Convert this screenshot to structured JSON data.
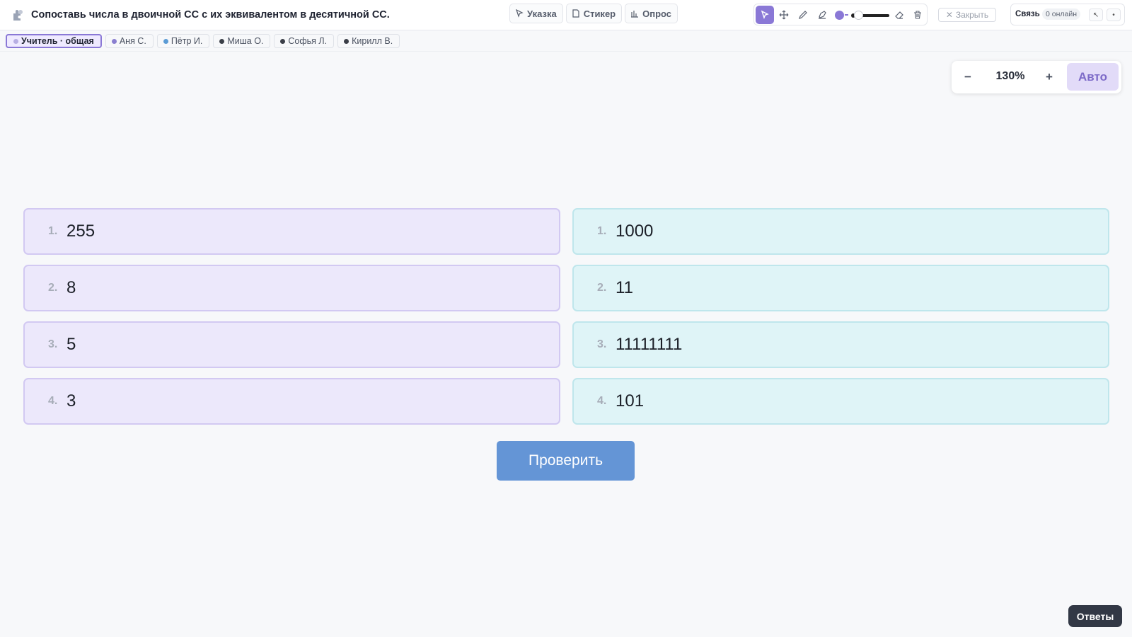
{
  "header": {
    "title": "Сопоставь числа в двоичной СС с их эквивалентом в десятичной СС.",
    "tools": [
      {
        "label": "Указка",
        "icon": "pointer-icon"
      },
      {
        "label": "Стикер",
        "icon": "sticker-icon"
      },
      {
        "label": "Опрос",
        "icon": "poll-icon"
      }
    ],
    "close_label": "Закрыть",
    "connection_label": "Связь",
    "online_label": "0 онлайн"
  },
  "tabs": [
    {
      "label": "Учитель · общая",
      "active": true,
      "dot_color": "#b7aee3"
    },
    {
      "label": "Аня С.",
      "active": false,
      "dot_color": "#8a7fd0"
    },
    {
      "label": "Пётр И.",
      "active": false,
      "dot_color": "#5b9bd5"
    },
    {
      "label": "Миша О.",
      "active": false,
      "dot_color": "#3b3f48"
    },
    {
      "label": "Софья Л.",
      "active": false,
      "dot_color": "#3b3f48"
    },
    {
      "label": "Кирилл В.",
      "active": false,
      "dot_color": "#3b3f48"
    }
  ],
  "zoom": {
    "minus": "−",
    "value": "130%",
    "plus": "+",
    "auto": "Авто"
  },
  "left_items": [
    {
      "num": "1.",
      "value": "255"
    },
    {
      "num": "2.",
      "value": "8"
    },
    {
      "num": "3.",
      "value": "5"
    },
    {
      "num": "4.",
      "value": "3"
    }
  ],
  "right_items": [
    {
      "num": "1.",
      "value": "1000"
    },
    {
      "num": "2.",
      "value": "11"
    },
    {
      "num": "3.",
      "value": "11111111"
    },
    {
      "num": "4.",
      "value": "101"
    }
  ],
  "check_label": "Проверить",
  "answers_label": "Ответы",
  "colors": {
    "accent": "#8a78d6",
    "check_button": "#6495d6",
    "left_card": "#ece8fb",
    "right_card": "#dff4f7"
  }
}
